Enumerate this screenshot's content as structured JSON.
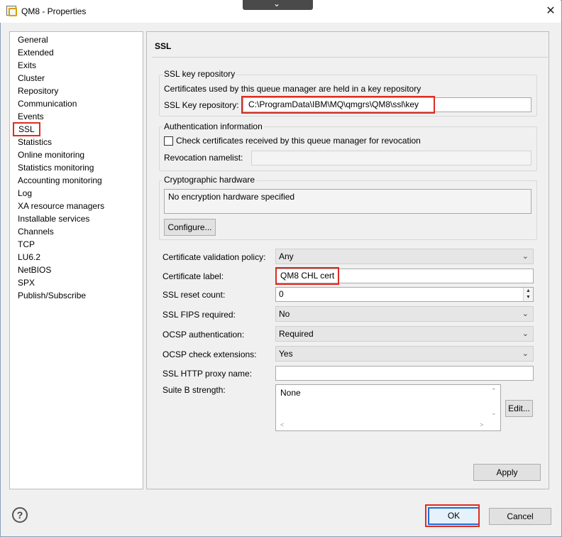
{
  "window": {
    "title": "QM8 - Properties",
    "close_glyph": "✕",
    "dropdown_glyph": "⌄"
  },
  "nav": {
    "items": [
      {
        "label": "General"
      },
      {
        "label": "Extended"
      },
      {
        "label": "Exits"
      },
      {
        "label": "Cluster"
      },
      {
        "label": "Repository"
      },
      {
        "label": "Communication"
      },
      {
        "label": "Events"
      },
      {
        "label": "SSL",
        "selected": true
      },
      {
        "label": "Statistics"
      },
      {
        "label": "Online monitoring"
      },
      {
        "label": "Statistics monitoring"
      },
      {
        "label": "Accounting monitoring"
      },
      {
        "label": "Log"
      },
      {
        "label": "XA resource managers"
      },
      {
        "label": "Installable services"
      },
      {
        "label": "Channels"
      },
      {
        "label": "TCP"
      },
      {
        "label": "LU6.2"
      },
      {
        "label": "NetBIOS"
      },
      {
        "label": "SPX"
      },
      {
        "label": "Publish/Subscribe"
      }
    ]
  },
  "ssl": {
    "title": "SSL",
    "key_repo_group": {
      "legend": "SSL key repository",
      "description": "Certificates used by this queue manager are held in a key repository",
      "label": "SSL Key repository:",
      "value": "C:\\ProgramData\\IBM\\MQ\\qmgrs\\QM8\\ssl\\key"
    },
    "auth_group": {
      "legend": "Authentication information",
      "check_label": "Check certificates received by this queue manager for revocation",
      "check_checked": false,
      "namelist_label": "Revocation namelist:",
      "namelist_value": ""
    },
    "crypto_group": {
      "legend": "Cryptographic hardware",
      "value": "No encryption hardware specified",
      "configure_label": "Configure..."
    },
    "fields": {
      "validation_policy": {
        "label": "Certificate validation policy:",
        "value": "Any"
      },
      "cert_label": {
        "label": "Certificate label:",
        "value": "QM8 CHL cert"
      },
      "reset_count": {
        "label": "SSL reset count:",
        "value": "0"
      },
      "fips": {
        "label": "SSL FIPS required:",
        "value": "No"
      },
      "ocsp_auth": {
        "label": "OCSP authentication:",
        "value": "Required"
      },
      "ocsp_ext": {
        "label": "OCSP check extensions:",
        "value": "Yes"
      },
      "proxy": {
        "label": "SSL HTTP proxy name:",
        "value": ""
      },
      "suite_b": {
        "label": "Suite B strength:",
        "value": "None",
        "edit_label": "Edit..."
      }
    },
    "apply_label": "Apply"
  },
  "footer": {
    "help_glyph": "?",
    "ok_label": "OK",
    "cancel_label": "Cancel"
  },
  "colors": {
    "highlight": "#e02b20",
    "focus": "#1d6fd6"
  }
}
